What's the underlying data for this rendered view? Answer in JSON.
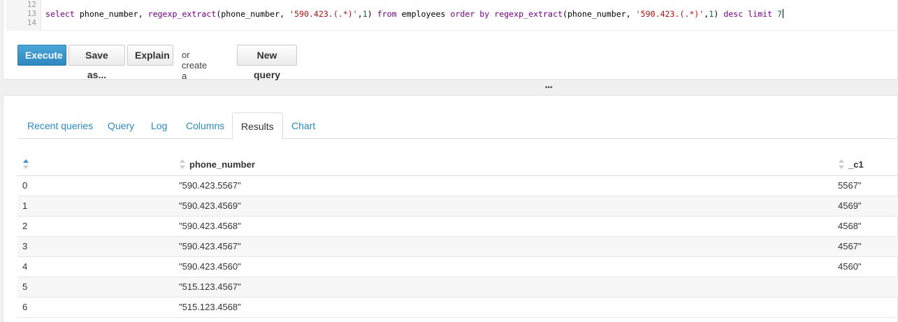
{
  "editor": {
    "line_numbers": [
      "12",
      "13",
      "14"
    ],
    "code": {
      "kw_select": "select",
      "t1": " phone_number, ",
      "fn1": "regexp_extract",
      "t2": "(phone_number, ",
      "str1": "'590.423.(.*)'",
      "t3": ",",
      "num1": "1",
      "t4": ") ",
      "kw_from": "from",
      "t5": " employees ",
      "kw_order": "order by",
      "t6": " ",
      "fn2": "regexp_extract",
      "t7": "(phone_number, ",
      "str2": "'590.423.(.*)'",
      "t8": ",",
      "num2": "1",
      "t9": ") ",
      "kw_desc": "desc",
      "t10": " ",
      "kw_limit": "limit",
      "t11": " ",
      "num3": "7"
    }
  },
  "toolbar": {
    "execute_label": "Execute",
    "save_label": "Save as...",
    "explain_label": "Explain",
    "or_text": "or create a",
    "new_query_label": "New query"
  },
  "splitter": {
    "grip": "▪▪▪"
  },
  "tabs": [
    {
      "label": "Recent queries"
    },
    {
      "label": "Query"
    },
    {
      "label": "Log"
    },
    {
      "label": "Columns"
    },
    {
      "label": "Results"
    },
    {
      "label": "Chart"
    }
  ],
  "results": {
    "headers": [
      "",
      "phone_number",
      "_c1"
    ],
    "rows": [
      [
        "0",
        "\"590.423.5567\"",
        "5567\""
      ],
      [
        "1",
        "\"590.423.4569\"",
        "4569\""
      ],
      [
        "2",
        "\"590.423.4568\"",
        "4568\""
      ],
      [
        "3",
        "\"590.423.4567\"",
        "4567\""
      ],
      [
        "4",
        "\"590.423.4560\"",
        "4560\""
      ],
      [
        "5",
        "\"515.123.4567\"",
        ""
      ],
      [
        "6",
        "\"515.123.4568\"",
        ""
      ]
    ]
  },
  "colors": {
    "accent": "#2a8ac3",
    "primary_button": "#3592c9",
    "sort_active": "#3b8fd4"
  }
}
